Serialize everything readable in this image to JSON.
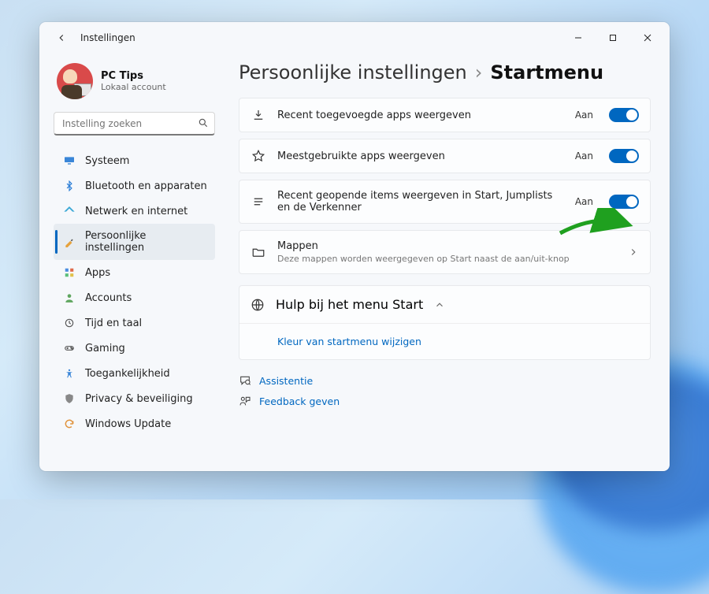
{
  "window": {
    "title": "Instellingen"
  },
  "profile": {
    "name": "PC Tips",
    "sub": "Lokaal account"
  },
  "search": {
    "placeholder": "Instelling zoeken"
  },
  "nav": {
    "items": [
      {
        "label": "Systeem"
      },
      {
        "label": "Bluetooth en apparaten"
      },
      {
        "label": "Netwerk en internet"
      },
      {
        "label": "Persoonlijke instellingen"
      },
      {
        "label": "Apps"
      },
      {
        "label": "Accounts"
      },
      {
        "label": "Tijd en taal"
      },
      {
        "label": "Gaming"
      },
      {
        "label": "Toegankelijkheid"
      },
      {
        "label": "Privacy & beveiliging"
      },
      {
        "label": "Windows Update"
      }
    ]
  },
  "breadcrumb": {
    "parent": "Persoonlijke instellingen",
    "current": "Startmenu"
  },
  "settings": {
    "recent_apps": {
      "label": "Recent toegevoegde apps weergeven",
      "state": "Aan"
    },
    "most_used": {
      "label": "Meestgebruikte apps weergeven",
      "state": "Aan"
    },
    "recent_items": {
      "label": "Recent geopende items weergeven in Start, Jumplists en de Verkenner",
      "state": "Aan"
    },
    "folders": {
      "label": "Mappen",
      "sub": "Deze mappen worden weergegeven op Start naast de aan/uit-knop"
    }
  },
  "help": {
    "header": "Hulp bij het menu Start",
    "link": "Kleur van startmenu wijzigen"
  },
  "footer": {
    "assist": "Assistentie",
    "feedback": "Feedback geven"
  }
}
